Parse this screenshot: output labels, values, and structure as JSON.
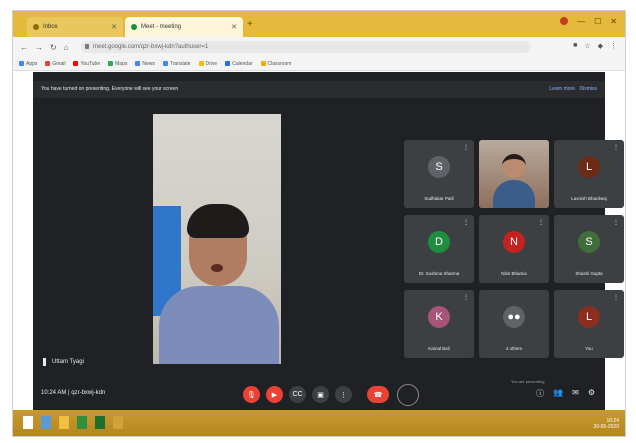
{
  "browser": {
    "tabs": [
      {
        "label": "Inbox"
      },
      {
        "label": "Meet - meeting"
      }
    ],
    "new_tab": "+",
    "address": "meet.google.com/qzr-bxwj-kdn?authuser=1",
    "bookmarks": [
      "Apps",
      "Gmail",
      "YouTube",
      "Maps",
      "News",
      "Translate",
      "Drive",
      "Calendar",
      "Classroom"
    ]
  },
  "meet": {
    "banner": {
      "message": "You have turned on presenting. Everyone will see your screen",
      "action_1": "Learn more",
      "action_2": "Dismiss"
    },
    "pinned_name": "Uttam Tyagi",
    "time": "10:24 AM",
    "meeting_code": "qzr-bxwj-kdn",
    "presenting_note": "You are presenting",
    "participants": [
      {
        "name": "Sudhakar Patil",
        "initial": "S",
        "color": "#5f6368",
        "camera": false
      },
      {
        "name": "",
        "initial": "",
        "color": "#9c7c66",
        "camera": true
      },
      {
        "name": "Lavnish Bhardwaj",
        "initial": "L",
        "color": "#6d2b17",
        "camera": false
      },
      {
        "name": "Dr. Sushma Sharma",
        "initial": "D",
        "color": "#1e8e3e",
        "camera": false
      },
      {
        "name": "Nitin Bhamia",
        "initial": "N",
        "color": "#c5221f",
        "camera": false
      },
      {
        "name": "Shashi Gupta",
        "initial": "S",
        "color": "#3f6e3b",
        "camera": false
      },
      {
        "name": "Kamal Bali",
        "initial": "K",
        "color": "#a6547a",
        "camera": false
      },
      {
        "name": "4 others",
        "initial": "",
        "color": "#5f6368",
        "camera": false
      },
      {
        "name": "You",
        "initial": "L",
        "color": "#8b2d1f",
        "camera": false
      }
    ]
  },
  "taskbar": {
    "time": "10:24",
    "date": "30-05-2020"
  }
}
